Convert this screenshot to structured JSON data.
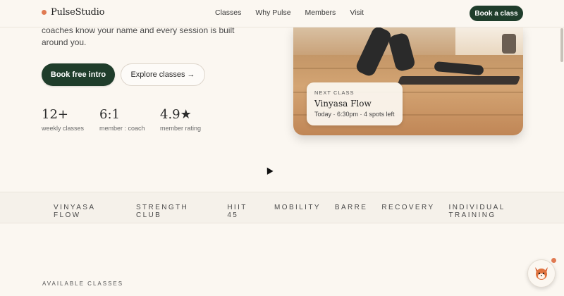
{
  "header": {
    "brand": "PulseStudio",
    "nav": [
      "Classes",
      "Why Pulse",
      "Members",
      "Visit"
    ],
    "cta": "Book a class"
  },
  "hero": {
    "text": "coaches know your name and every session is built around you.",
    "primary_button": "Book free intro",
    "secondary_button": "Explore classes →",
    "stats": [
      {
        "value": "12+",
        "label": "weekly classes"
      },
      {
        "value": "6:1",
        "label": "member : coach"
      },
      {
        "value": "4.9★",
        "label": "member rating"
      }
    ],
    "next_class": {
      "kicker": "NEXT CLASS",
      "title": "Vinyasa Flow",
      "meta": "Today · 6:30pm · 4 spots left"
    }
  },
  "band": {
    "items": [
      "VINYASA FLOW",
      "STRENGTH CLUB",
      "HIIT 45",
      "MOBILITY",
      "BARRE",
      "RECOVERY",
      "INDIVIDUAL TRAINING"
    ]
  },
  "section": {
    "label": "AVAILABLE CLASSES"
  },
  "colors": {
    "accent": "#1f3d2b",
    "brand_dot": "#e07a52",
    "background": "#fbf7f1"
  }
}
